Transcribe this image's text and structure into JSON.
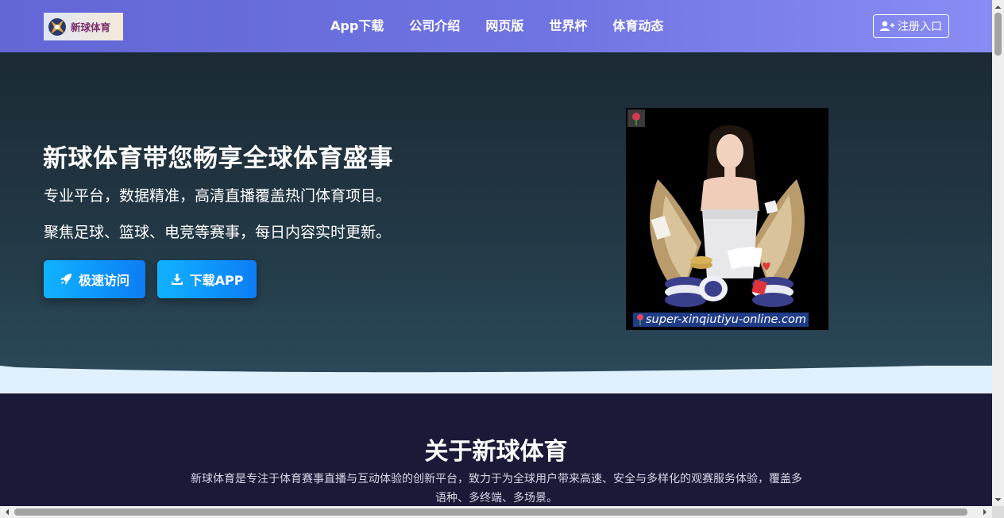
{
  "header": {
    "logo_text": "新球体育",
    "nav": [
      "App下载",
      "公司介绍",
      "网页版",
      "世界杯",
      "体育动态"
    ],
    "register_label": "注册入口"
  },
  "hero": {
    "title": "新球体育带您畅享全球体育盛事",
    "line1": "专业平台，数据精准，高清直播覆盖热门体育项目。",
    "line2": "聚焦足球、篮球、电竞等赛事，每日内容实时更新。",
    "btn_fast": "极速访问",
    "btn_download": "下载APP",
    "image_caption": "super-xinqiutiyu-online.com"
  },
  "about": {
    "title": "关于新球体育",
    "description": "新球体育是专注于体育赛事直播与互动体验的创新平台，致力于为全球用户带来高速、安全与多样化的观赛服务体验，覆盖多语种、多终端、多场景。"
  },
  "colors": {
    "header_start": "#6266d6",
    "header_end": "#8a8cf4",
    "hero_bg": "#223744",
    "button_accent": "#0d7df6",
    "about_bg": "#1a1a38"
  },
  "icons": [
    "rocket-icon",
    "download-icon",
    "user-plus-icon"
  ]
}
